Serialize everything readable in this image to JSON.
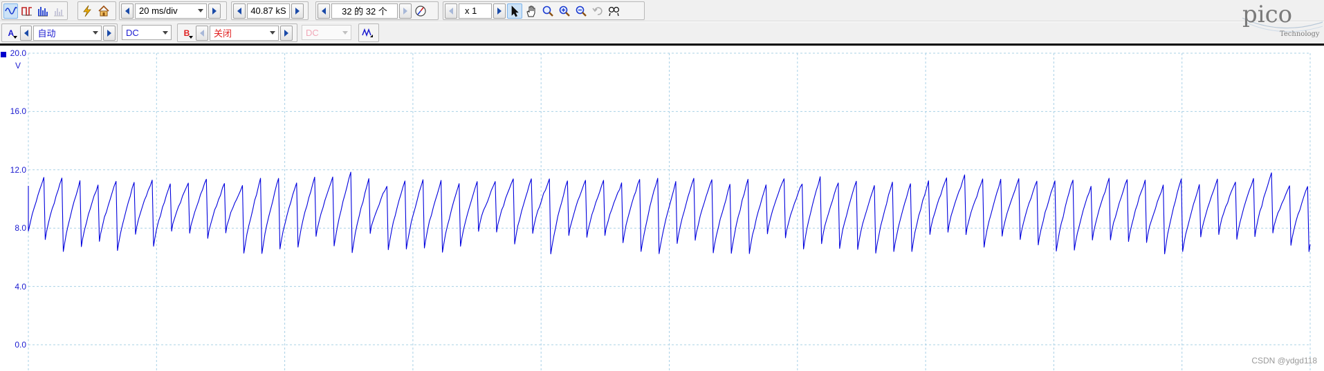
{
  "toolbar1": {
    "timebase": "20 ms/div",
    "samples": "40.87 kS",
    "buffer": "32 的 32 个",
    "zoom": "x 1",
    "tools": [
      "scope-mode-icon",
      "persistence-mode-icon",
      "spectrum-mode-icon",
      "disabled-spectrum-icon",
      "autosetup-icon",
      "home-icon",
      "pointer-icon",
      "hand-icon",
      "zoom-icon",
      "zoom-in-icon",
      "zoom-out-icon",
      "undo-zoom-icon",
      "zoom-overview-icon"
    ]
  },
  "toolbar2": {
    "channel_a": {
      "label": "A",
      "range": "自动",
      "coupling": "DC",
      "color": "#1a1ad0"
    },
    "channel_b": {
      "label": "B",
      "range": "关闭",
      "coupling": "DC",
      "color": "#e02020"
    }
  },
  "logo": {
    "brand": "pico",
    "tagline": "Technology"
  },
  "chart_data": {
    "type": "line",
    "series": [
      {
        "color": "#0000dd",
        "waveform": "sawtooth",
        "cycles": 71,
        "x": [
          0,
          1
        ],
        "y_low_approx": [
          6.2,
          7.8
        ],
        "y_high_approx": [
          10.9,
          11.9
        ]
      }
    ],
    "y_ticks": [
      "20.0",
      "16.0",
      "12.0",
      "8.0",
      "4.0",
      "0.0"
    ],
    "y_unit": "V",
    "ylim": [
      -1.8,
      20.0
    ],
    "grid": true,
    "grid_color": "#a8d0e6"
  },
  "watermark": "CSDN @ydgd118"
}
